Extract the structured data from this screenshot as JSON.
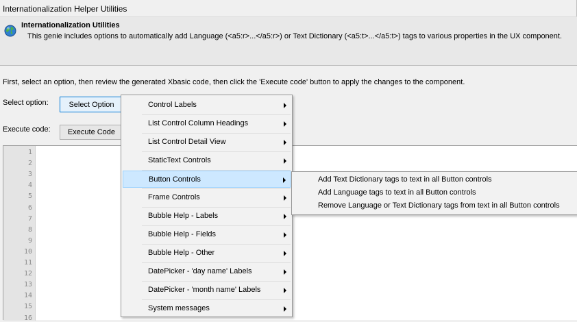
{
  "window": {
    "title": "Internationalization Helper Utilities"
  },
  "banner": {
    "heading": "Internationalization Utilities",
    "description": "This genie includes options to automatically add Language (<a5:r>...</a5:r>) or Text Dictionary (<a5:t>...</a5:t>)  tags to various properties in the UX component.",
    "icon": "globe-icon"
  },
  "instructions": "First, select an option, then review the generated Xbasic code, then click the 'Execute code' button to apply the changes to the component.",
  "select_option": {
    "label": "Select option:",
    "button": "Select Option"
  },
  "execute": {
    "label": "Execute code:",
    "button": "Execute Code"
  },
  "editor": {
    "line_numbers": [
      "1",
      "2",
      "3",
      "4",
      "5",
      "6",
      "7",
      "8",
      "9",
      "10",
      "11",
      "12",
      "13",
      "14",
      "15",
      "16"
    ]
  },
  "menu": {
    "items": [
      {
        "label": "Control Labels"
      },
      {
        "label": "List Control Column Headings"
      },
      {
        "label": "List Control Detail View"
      },
      {
        "label": "StaticText Controls"
      },
      {
        "label": "Button Controls"
      },
      {
        "label": "Frame Controls"
      },
      {
        "label": "Bubble Help - Labels"
      },
      {
        "label": "Bubble Help - Fields"
      },
      {
        "label": "Bubble Help - Other"
      },
      {
        "label": "DatePicker - 'day name' Labels"
      },
      {
        "label": "DatePicker - 'month name' Labels"
      },
      {
        "label": "System messages"
      }
    ],
    "highlighted": "Button Controls",
    "submenu": [
      {
        "label": "Add Text Dictionary tags to text in all Button controls"
      },
      {
        "label": "Add Language tags to text in all Button controls"
      },
      {
        "label": "Remove Language or Text Dictionary tags from text in all Button controls"
      }
    ]
  },
  "colors": {
    "highlight": "#cde8ff",
    "highlight_border": "#99d1ff",
    "focus_border": "#0078d7"
  }
}
